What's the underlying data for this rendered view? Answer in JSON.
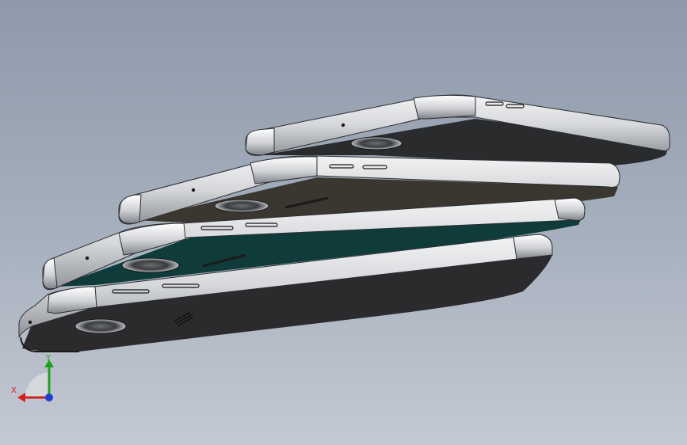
{
  "scene": {
    "background_top": "#8e99aa",
    "background_bottom": "#c3c9d3",
    "models": [
      {
        "name": "phone-model-1",
        "back_color": "#2a2b2d"
      },
      {
        "name": "phone-model-2",
        "back_color": "#3a3630"
      },
      {
        "name": "phone-model-3",
        "back_color": "#0f3b3a"
      },
      {
        "name": "phone-model-4",
        "back_color": "#2b2b2d"
      }
    ],
    "frame_color": "#d4d6d9"
  },
  "triad": {
    "x_label": "X",
    "y_label": "Y",
    "x_color": "#d22020",
    "y_color": "#20a020",
    "z_color": "#2040d0"
  }
}
